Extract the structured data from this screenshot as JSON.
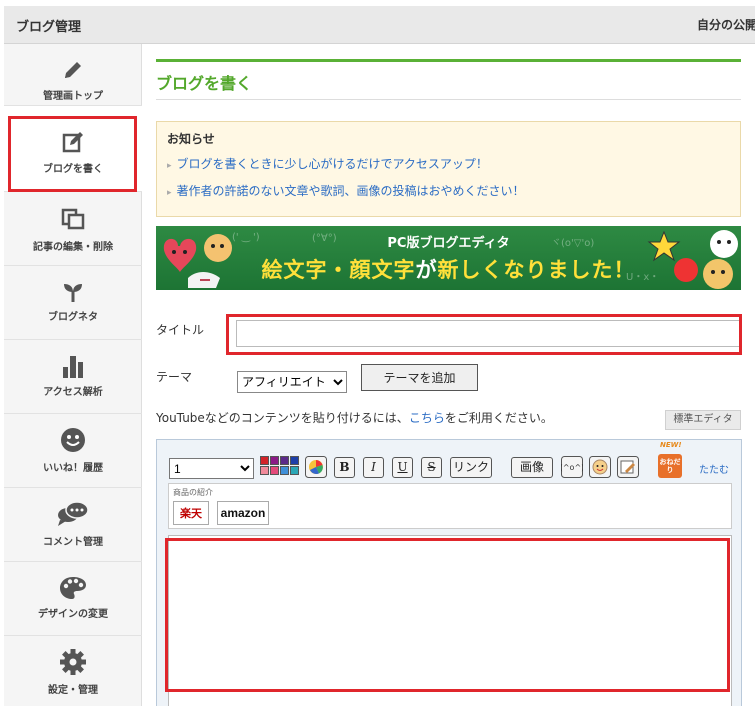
{
  "header": {
    "title": "ブログ管理",
    "public_link": "自分の公開"
  },
  "sidebar": {
    "items": [
      {
        "label": "管理画トップ",
        "icon": "pencil-icon"
      },
      {
        "label": "ブログを書く",
        "icon": "edit-icon",
        "active": true
      },
      {
        "label": "記事の編集・削除",
        "icon": "copy-icon"
      },
      {
        "label": "ブログネタ",
        "icon": "sprout-icon"
      },
      {
        "label": "アクセス解析",
        "icon": "bar-chart-icon"
      },
      {
        "label": "いいね！履歴",
        "icon": "smile-icon"
      },
      {
        "label": "コメント管理",
        "icon": "comment-icon"
      },
      {
        "label": "デザインの変更",
        "icon": "palette-icon"
      },
      {
        "label": "設定・管理",
        "icon": "gear-icon"
      }
    ]
  },
  "main": {
    "page_title": "ブログを書く",
    "notice": {
      "title": "お知らせ",
      "items": [
        "ブログを書くときに少し心がけるだけでアクセスアップ！",
        "著作者の許諾のない文章や歌詞、画像の投稿はおやめください！"
      ]
    },
    "banner": {
      "line1": "PC版ブログエディタ",
      "line2_a": "絵文字・顔文字",
      "line2_b": "が",
      "line2_c": "新しくなりました！"
    },
    "form": {
      "title_label": "タイトル",
      "title_value": "",
      "theme_label": "テーマ",
      "theme_selected": "アフィリエイト",
      "add_theme_button": "テーマを追加"
    },
    "youtube_note": {
      "before": "YouTubeなどのコンテンツを貼り付けるには、",
      "link": "こちら",
      "after": "をご利用ください。"
    },
    "standard_editor_button": "標準エディタ",
    "editor": {
      "font_size": "1",
      "bold": "B",
      "italic": "I",
      "underline": "U",
      "strike": "S",
      "link": "リンク",
      "image": "画像",
      "collapse": "たたむ",
      "new_badge": "NEW!",
      "recommend_badge": "おねだり",
      "products_title": "商品の紹介",
      "rakuten": "楽天",
      "amazon": "amazon",
      "body": ""
    },
    "colors": {
      "accent_green": "#53a82b",
      "link_blue": "#2b6cc4",
      "highlight_red": "#e0262c"
    }
  }
}
